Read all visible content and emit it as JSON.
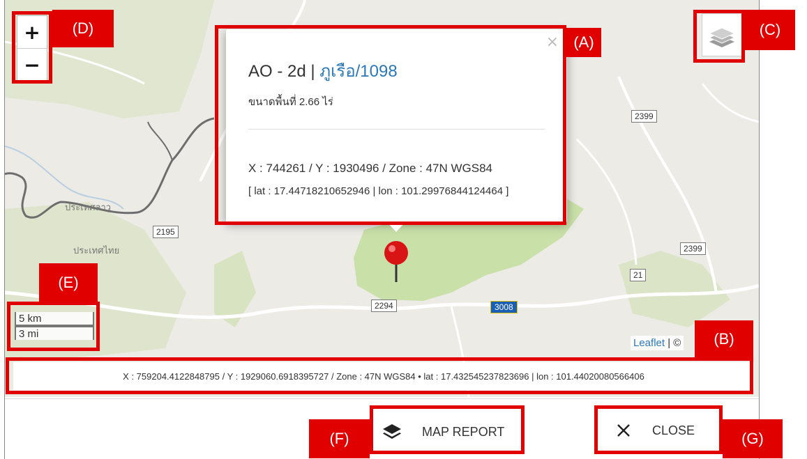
{
  "popup": {
    "title_prefix": "AO - 2d | ",
    "title_link": "ภูเรือ/1098",
    "area": "ขนาดพื้นที่ 2.66 ไร่",
    "close_glyph": "×",
    "xy": "X : 744261 / Y : 1930496 / Zone : 47N WGS84",
    "latlon": "[ lat : 17.44718210652946 | lon : 101.29976844124464 ]"
  },
  "map": {
    "zoom_in": "+",
    "zoom_out": "−",
    "route_labels": [
      "2399",
      "2195",
      "2399",
      "21",
      "2294",
      "3008"
    ],
    "place_labels": [
      "ประเทศลาว",
      "ประเทศไทย"
    ],
    "scale_km": "5 km",
    "scale_mi": "3 mi",
    "attribution_link": "Leaflet",
    "attribution_rest": " | ©"
  },
  "coordbar": {
    "text": "X : 759204.4122848795 / Y : 1929060.6918395727 / Zone : 47N WGS84 • lat : 17.432545237823696 | lon : 101.44020080566406"
  },
  "footer": {
    "map_report_label": "MAP REPORT",
    "close_label": "CLOSE"
  },
  "annotations": {
    "A": "(A)",
    "B": "(B)",
    "C": "(C)",
    "D": "(D)",
    "E": "(E)",
    "F": "(F)",
    "G": "(G)"
  },
  "colors": {
    "annotation": "#e00000",
    "forest": "#c9e0a8",
    "link": "#2b78b8",
    "pin": "#d81414"
  },
  "icons": {
    "layers": "layers-icon",
    "pin": "map-pin-icon",
    "map_report": "stack-icon",
    "close": "close-icon"
  }
}
